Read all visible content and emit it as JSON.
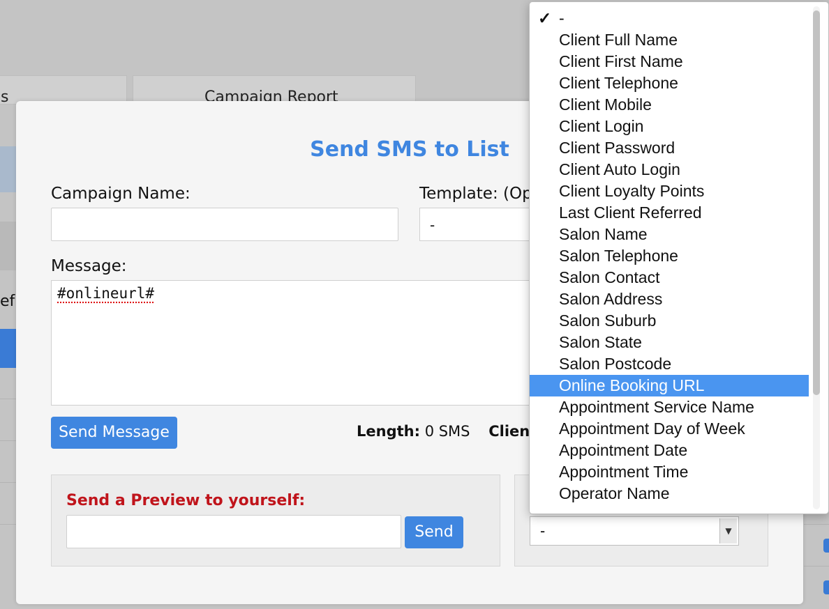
{
  "background": {
    "tabs": [
      {
        "label": "s"
      },
      {
        "label": "Campaign Report"
      }
    ],
    "side_text": "ef"
  },
  "modal": {
    "title": "Send SMS to List",
    "campaign_name_label": "Campaign Name:",
    "campaign_name_value": "",
    "template_label": "Template: (Op",
    "template_value": "-",
    "message_label": "Message:",
    "message_value": "#onlineurl#",
    "send_message_button": "Send Message",
    "length_label": "Length:",
    "length_value": "0 SMS",
    "clients_label": "Clients:",
    "preview": {
      "title": "Send a Preview to yourself:",
      "input_value": "",
      "send_button": "Send"
    },
    "right_select_value": "-"
  },
  "dropdown": {
    "checked_item": "-",
    "items": [
      {
        "label": "-",
        "checked": true
      },
      {
        "label": "Client Full Name"
      },
      {
        "label": "Client First Name"
      },
      {
        "label": "Client Telephone"
      },
      {
        "label": "Client Mobile"
      },
      {
        "label": "Client Login"
      },
      {
        "label": "Client Password"
      },
      {
        "label": "Client Auto Login"
      },
      {
        "label": "Client Loyalty Points"
      },
      {
        "label": "Last Client Referred"
      },
      {
        "label": "Salon Name"
      },
      {
        "label": "Salon Telephone"
      },
      {
        "label": "Salon Contact"
      },
      {
        "label": "Salon Address"
      },
      {
        "label": "Salon Suburb"
      },
      {
        "label": "Salon State"
      },
      {
        "label": "Salon Postcode"
      },
      {
        "label": "Online Booking URL",
        "selected": true
      },
      {
        "label": "Appointment Service Name"
      },
      {
        "label": "Appointment Day of Week"
      },
      {
        "label": "Appointment Date"
      },
      {
        "label": "Appointment Time"
      },
      {
        "label": "Operator Name"
      }
    ]
  },
  "colors": {
    "accent": "#3f86e0",
    "preview_title": "#c0141b",
    "highlight": "#4a95f0"
  }
}
